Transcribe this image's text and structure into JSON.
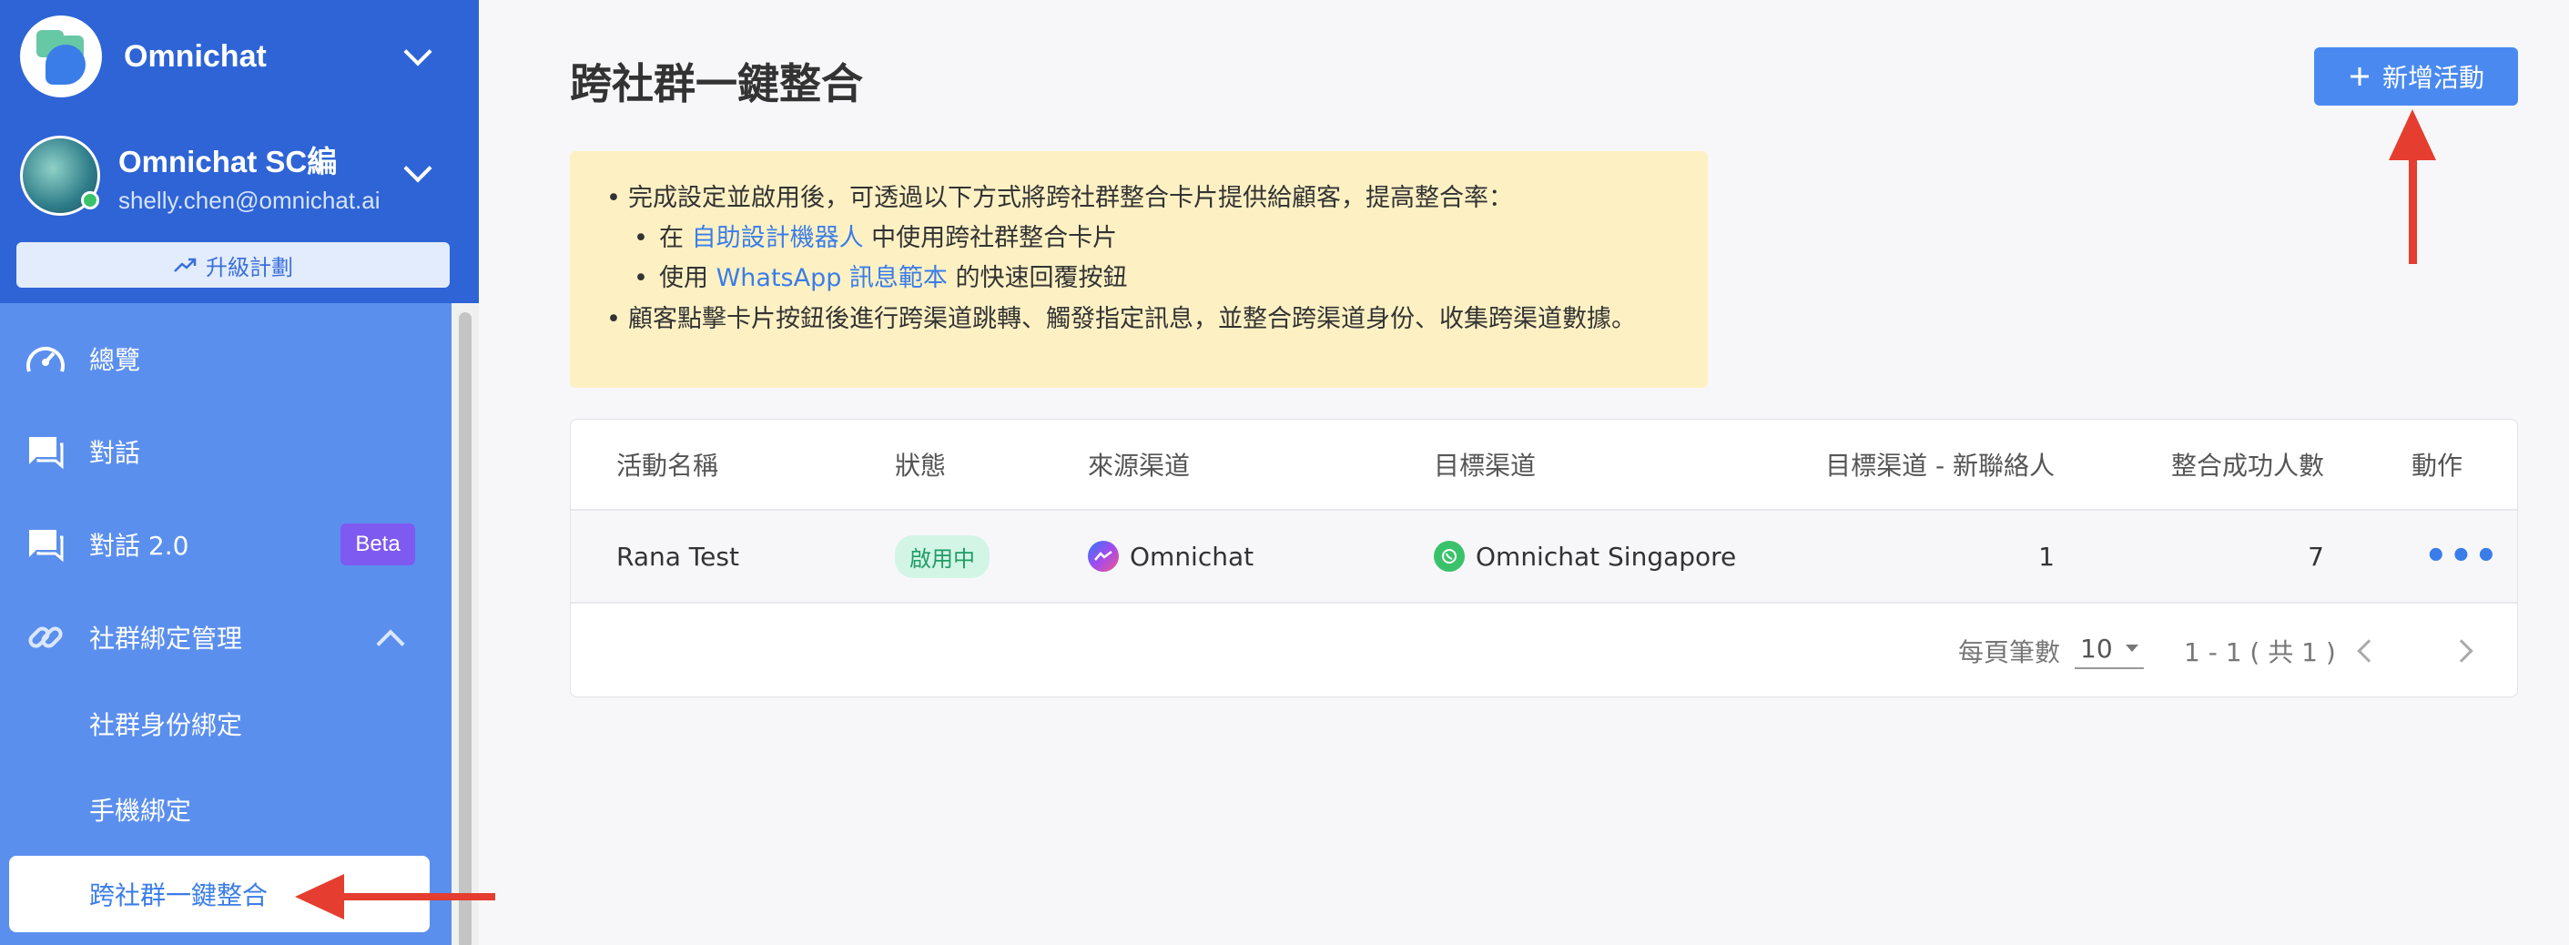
{
  "sidebar": {
    "workspace": "Omnichat",
    "user": {
      "name": "Omnichat SC編",
      "email": "shelly.chen@omnichat.ai"
    },
    "upgrade_label": "升級計劃",
    "nav": [
      {
        "label": "總覽",
        "icon": "dashboard-gauge-icon"
      },
      {
        "label": "對話",
        "icon": "chat-icon"
      },
      {
        "label": "對話 2.0",
        "icon": "chat-icon",
        "badge": "Beta"
      },
      {
        "label": "社群綁定管理",
        "icon": "link-icon"
      }
    ],
    "sub_nav": [
      "社群身份綁定",
      "手機綁定",
      "跨社群一鍵整合"
    ]
  },
  "header": {
    "title": "跨社群一鍵整合",
    "add_button": "新增活動"
  },
  "notice": {
    "line1": "完成設定並啟用後，可透過以下方式將跨社群整合卡片提供給顧客，提高整合率：",
    "sub1_pre": "在 ",
    "sub1_link": "自助設計機器人",
    "sub1_post": " 中使用跨社群整合卡片",
    "sub2_pre": "使用 ",
    "sub2_link": "WhatsApp 訊息範本",
    "sub2_post": " 的快速回覆按鈕",
    "line2": "顧客點擊卡片按鈕後進行跨渠道跳轉、觸發指定訊息，並整合跨渠道身份、收集跨渠道數據。"
  },
  "table": {
    "headers": [
      "活動名稱",
      "狀態",
      "來源渠道",
      "目標渠道",
      "目標渠道 - 新聯絡人",
      "整合成功人數",
      "動作"
    ],
    "rows": [
      {
        "name": "Rana Test",
        "status": "啟用中",
        "source": "Omnichat",
        "target": "Omnichat Singapore",
        "new_contacts": "1",
        "success": "7",
        "action": "•••"
      }
    ],
    "pager": {
      "per_page_label": "每頁筆數",
      "per_page": "10",
      "range": "1 - 1 ( 共 1 )"
    }
  },
  "colors": {
    "sidebar_top": "#2e64d5",
    "sidebar": "#5b8fee",
    "accent": "#4a8af0",
    "notice_bg": "#fdf1c4",
    "annotation_arrow": "#e53d2f"
  }
}
